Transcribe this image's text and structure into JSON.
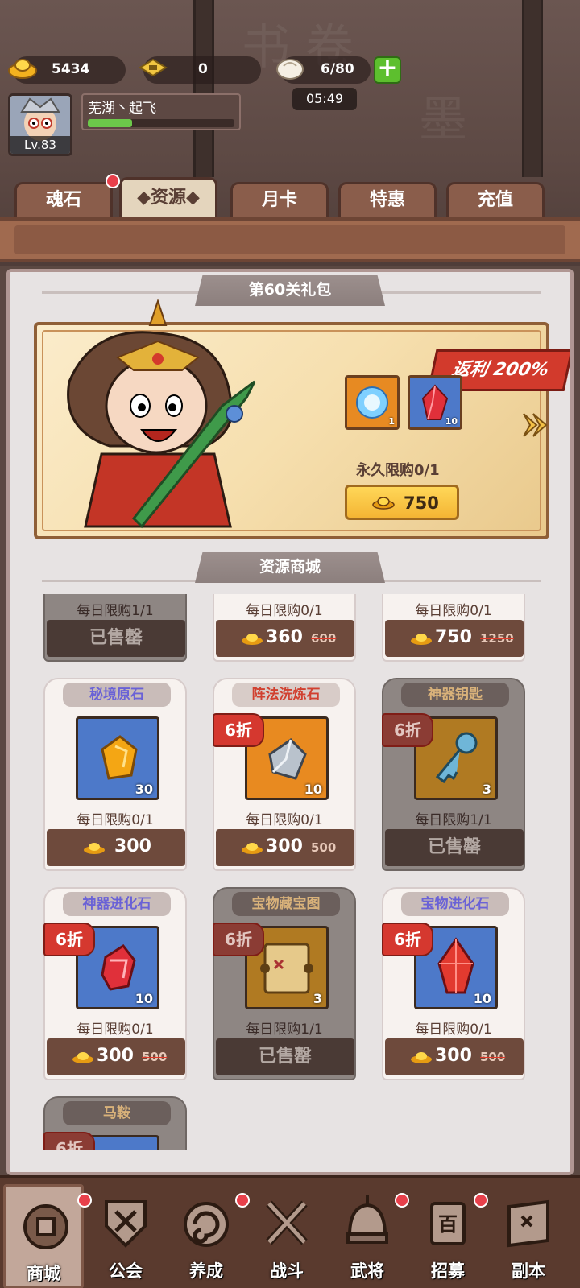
{
  "resources": {
    "gold": "5434",
    "tickets": "0",
    "stamina": "6/80",
    "timer": "05:49"
  },
  "player": {
    "name": "芜湖丶起飞",
    "level": "Lv.83",
    "exp_fraction": 0.3
  },
  "tabs": [
    {
      "label": "魂石"
    },
    {
      "label": "◆资源◆"
    },
    {
      "label": "月卡"
    },
    {
      "label": "特惠"
    },
    {
      "label": "充值"
    }
  ],
  "gift": {
    "title": "第60关礼包",
    "rebate": "返利 200%",
    "items": [
      {
        "icon": "blue-orb-icon",
        "count": "1"
      },
      {
        "icon": "red-crystal-icon",
        "count": "10"
      }
    ],
    "limit": "永久限购0/1",
    "price": "750"
  },
  "shop": {
    "title": "资源商城",
    "row0": [
      {
        "daily": "每日限购1/1",
        "sold": "已售罄"
      },
      {
        "daily": "每日限购0/1",
        "price": "360",
        "old": "600"
      },
      {
        "daily": "每日限购0/1",
        "price": "750",
        "old": "1250"
      }
    ],
    "row1": [
      {
        "name": "秘境原石",
        "count": "30",
        "daily": "每日限购0/1",
        "price": "300"
      },
      {
        "name": "阵法洗炼石",
        "discount": "6折",
        "count": "10",
        "daily": "每日限购0/1",
        "price": "300",
        "old": "500"
      },
      {
        "name": "神器钥匙",
        "discount": "6折",
        "count": "3",
        "daily": "每日限购1/1",
        "sold": "已售罄"
      }
    ],
    "row2": [
      {
        "name": "神器进化石",
        "discount": "6折",
        "count": "10",
        "daily": "每日限购0/1",
        "price": "300",
        "old": "500"
      },
      {
        "name": "宝物藏宝图",
        "discount": "6折",
        "count": "3",
        "daily": "每日限购1/1",
        "sold": "已售罄"
      },
      {
        "name": "宝物进化石",
        "discount": "6折",
        "count": "10",
        "daily": "每日限购0/1",
        "price": "300",
        "old": "500"
      }
    ],
    "row3": [
      {
        "name": "马鞍",
        "discount": "6折"
      }
    ]
  },
  "nav": [
    {
      "label": "商城",
      "icon": "shop-coin-icon"
    },
    {
      "label": "公会",
      "icon": "guild-shield-icon"
    },
    {
      "label": "养成",
      "icon": "swirl-icon"
    },
    {
      "label": "战斗",
      "icon": "crossed-swords-icon"
    },
    {
      "label": "武将",
      "icon": "helmet-icon"
    },
    {
      "label": "招募",
      "icon": "recruit-banner-icon"
    },
    {
      "label": "副本",
      "icon": "map-scroll-icon"
    }
  ],
  "colors": {
    "accent_red": "#d5382f",
    "gold_button": "#ffd758",
    "card_title_purple": "#6a62d6",
    "panel_bg": "#e7e3e3"
  }
}
